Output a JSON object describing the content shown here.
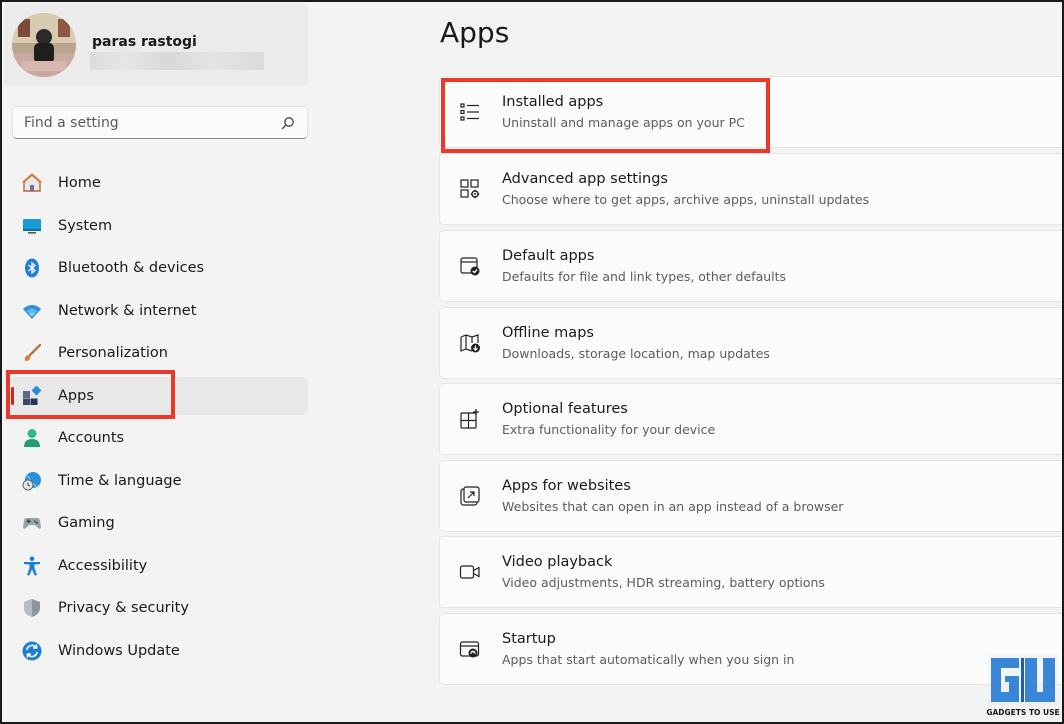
{
  "user": {
    "name": "paras rastogi"
  },
  "search": {
    "placeholder": "Find a setting"
  },
  "nav": [
    {
      "label": "Home",
      "icon": "home-icon"
    },
    {
      "label": "System",
      "icon": "system-icon"
    },
    {
      "label": "Bluetooth & devices",
      "icon": "bluetooth-icon"
    },
    {
      "label": "Network & internet",
      "icon": "wifi-icon"
    },
    {
      "label": "Personalization",
      "icon": "brush-icon"
    },
    {
      "label": "Apps",
      "icon": "apps-icon",
      "active": true
    },
    {
      "label": "Accounts",
      "icon": "person-icon"
    },
    {
      "label": "Time & language",
      "icon": "globe-clock-icon"
    },
    {
      "label": "Gaming",
      "icon": "gamepad-icon"
    },
    {
      "label": "Accessibility",
      "icon": "accessibility-icon"
    },
    {
      "label": "Privacy & security",
      "icon": "shield-icon"
    },
    {
      "label": "Windows Update",
      "icon": "update-icon"
    }
  ],
  "main": {
    "title": "Apps",
    "cards": [
      {
        "title": "Installed apps",
        "subtitle": "Uninstall and manage apps on your PC",
        "icon": "list-icon"
      },
      {
        "title": "Advanced app settings",
        "subtitle": "Choose where to get apps, archive apps, uninstall updates",
        "icon": "app-gear-icon"
      },
      {
        "title": "Default apps",
        "subtitle": "Defaults for file and link types, other defaults",
        "icon": "default-check-icon"
      },
      {
        "title": "Offline maps",
        "subtitle": "Downloads, storage location, map updates",
        "icon": "map-icon"
      },
      {
        "title": "Optional features",
        "subtitle": "Extra functionality for your device",
        "icon": "grid-plus-icon"
      },
      {
        "title": "Apps for websites",
        "subtitle": "Websites that can open in an app instead of a browser",
        "icon": "open-external-icon"
      },
      {
        "title": "Video playback",
        "subtitle": "Video adjustments, HDR streaming, battery options",
        "icon": "video-icon"
      },
      {
        "title": "Startup",
        "subtitle": "Apps that start automatically when you sign in",
        "icon": "startup-icon"
      }
    ]
  },
  "watermark": {
    "text": "GADGETS TO USE"
  },
  "colors": {
    "highlight": "#e8392a",
    "accent": "#0067c0",
    "active_bar": "#c42b1c"
  }
}
